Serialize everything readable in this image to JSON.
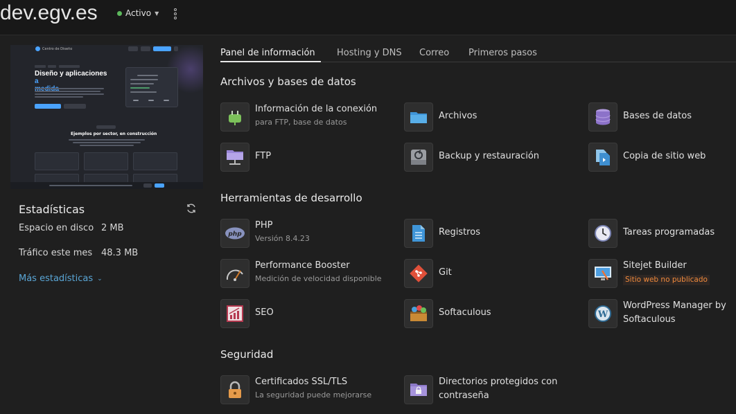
{
  "header": {
    "site_title": "dev.egv.es",
    "status_label": "Activo",
    "colors": {
      "status_dot": "#5cb85c"
    }
  },
  "preview": {
    "logo_text": "Centro de Diseño",
    "heading_line1": "Diseño y aplicaciones",
    "heading_accent": "a",
    "heading_line2": "medida",
    "section_heading": "Ejemplos por sector, en construcción"
  },
  "stats": {
    "title": "Estadísticas",
    "rows": [
      {
        "label": "Espacio en disco",
        "value": "2 MB"
      },
      {
        "label": "Tráfico este mes",
        "value": "48.3 MB"
      }
    ],
    "more_label": "Más estadísticas"
  },
  "tabs": [
    {
      "label": "Panel de información",
      "active": true
    },
    {
      "label": "Hosting y DNS"
    },
    {
      "label": "Correo"
    },
    {
      "label": "Primeros pasos"
    }
  ],
  "sections": {
    "files": "Archivos y bases de datos",
    "dev": "Herramientas de desarrollo",
    "security": "Seguridad"
  },
  "tools": {
    "connection": {
      "label": "Información de la conexión",
      "sub": "para FTP, base de datos",
      "icon": "plug-icon"
    },
    "files": {
      "label": "Archivos",
      "icon": "folder-icon"
    },
    "databases": {
      "label": "Bases de datos",
      "icon": "database-icon"
    },
    "ftp": {
      "label": "FTP",
      "icon": "ftp-folder-icon"
    },
    "backup": {
      "label": "Backup y restauración",
      "icon": "backup-icon"
    },
    "site_copy": {
      "label": "Copia de sitio web",
      "icon": "copy-icon"
    },
    "php": {
      "label": "PHP",
      "sub": "Versión 8.4.23",
      "icon": "php-icon"
    },
    "logs": {
      "label": "Registros",
      "icon": "log-file-icon"
    },
    "cron": {
      "label": "Tareas programadas",
      "icon": "clock-icon"
    },
    "booster": {
      "label": "Performance Booster",
      "sub": "Medición de velocidad disponible",
      "icon": "speedometer-icon"
    },
    "git": {
      "label": "Git",
      "icon": "git-icon"
    },
    "sitejet": {
      "label": "Sitejet Builder",
      "badge": "Sitio web no publicado",
      "icon": "sitejet-icon"
    },
    "seo": {
      "label": "SEO",
      "icon": "seo-chart-icon"
    },
    "softaculous": {
      "label": "Softaculous",
      "icon": "softaculous-icon"
    },
    "wordpress": {
      "label": "WordPress Manager by",
      "label2": "Softaculous",
      "icon": "wordpress-icon"
    },
    "ssl": {
      "label": "Certificados SSL/TLS",
      "sub": "La seguridad puede mejorarse",
      "icon": "lock-icon"
    },
    "protected_dirs": {
      "label": "Directorios protegidos con",
      "label2": "contraseña",
      "icon": "protected-folder-icon"
    }
  }
}
